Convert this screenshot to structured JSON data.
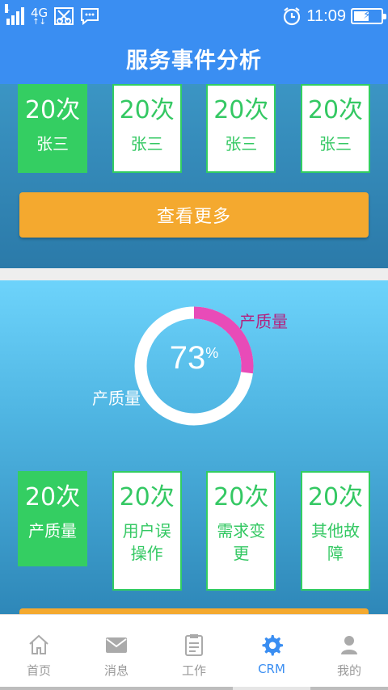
{
  "status_bar": {
    "sim_indicator": "1",
    "network_type": "4G",
    "time": "11:09",
    "battery_level": 0.55
  },
  "header": {
    "title": "服务事件分析"
  },
  "panel_top": {
    "cards": [
      {
        "count": "20次",
        "name": "张三",
        "active": true
      },
      {
        "count": "20次",
        "name": "张三",
        "active": false
      },
      {
        "count": "20次",
        "name": "张三",
        "active": false
      },
      {
        "count": "20次",
        "name": "张三",
        "active": false
      }
    ],
    "more_button": "查看更多"
  },
  "panel_bottom": {
    "donut": {
      "value": "73",
      "unit": "%",
      "highlight_fraction": 0.27,
      "label_highlight": "产质量",
      "label_main": "产质量",
      "highlight_color": "#e84bb8",
      "ring_color": "#ffffff"
    },
    "cards": [
      {
        "count": "20次",
        "name": "产质量",
        "active": true
      },
      {
        "count": "20次",
        "name": "用户误操作",
        "active": false
      },
      {
        "count": "20次",
        "name": "需求变更",
        "active": false
      },
      {
        "count": "20次",
        "name": "其他故障",
        "active": false
      }
    ]
  },
  "bottom_nav": [
    {
      "label": "首页",
      "icon": "home-icon",
      "active": false
    },
    {
      "label": "消息",
      "icon": "mail-icon",
      "active": false
    },
    {
      "label": "工作",
      "icon": "clipboard-icon",
      "active": false
    },
    {
      "label": "CRM",
      "icon": "gear-icon",
      "active": true
    },
    {
      "label": "我的",
      "icon": "user-icon",
      "active": false
    }
  ],
  "colors": {
    "primary": "#3a8ef2",
    "green": "#34ce62",
    "orange": "#f4a92f"
  }
}
